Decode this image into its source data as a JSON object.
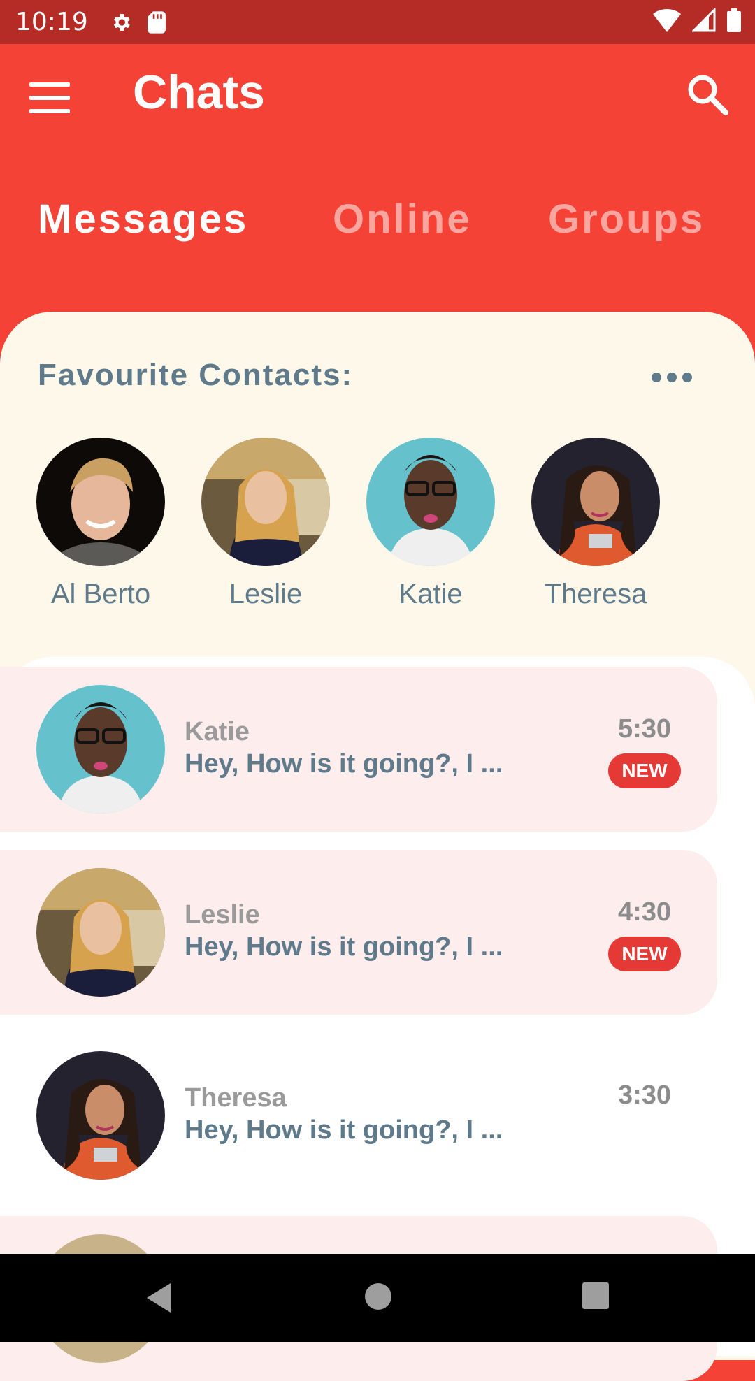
{
  "status_bar": {
    "time": "10:19",
    "icons": [
      "gear-icon",
      "sd-card-icon",
      "wifi-icon",
      "signal-icon",
      "battery-icon"
    ]
  },
  "app_bar": {
    "title": "Chats",
    "menu_icon": "menu-icon",
    "search_icon": "search-icon",
    "background": "#f44336"
  },
  "tabs": [
    {
      "label": "Messages",
      "active": true
    },
    {
      "label": "Online",
      "active": false
    },
    {
      "label": "Groups",
      "active": false
    }
  ],
  "favourites": {
    "title": "Favourite Contacts:",
    "contacts": [
      {
        "name": "Al Berto"
      },
      {
        "name": "Leslie"
      },
      {
        "name": "Katie"
      },
      {
        "name": "Theresa"
      }
    ]
  },
  "chats": [
    {
      "name": "Katie",
      "message": "Hey, How is it going?, I ...",
      "time": "5:30",
      "badge": "NEW",
      "unread": true
    },
    {
      "name": "Leslie",
      "message": "Hey, How is it going?, I ...",
      "time": "4:30",
      "badge": "NEW",
      "unread": true
    },
    {
      "name": "Theresa",
      "message": "Hey, How is it going?, I ...",
      "time": "3:30",
      "badge": "",
      "unread": false
    }
  ],
  "colors": {
    "accent": "#f44336",
    "badge": "#e53935",
    "text_primary": "#5f7a8a",
    "panel_bg": "#fef8eb",
    "unread_bg": "#fdeded"
  }
}
